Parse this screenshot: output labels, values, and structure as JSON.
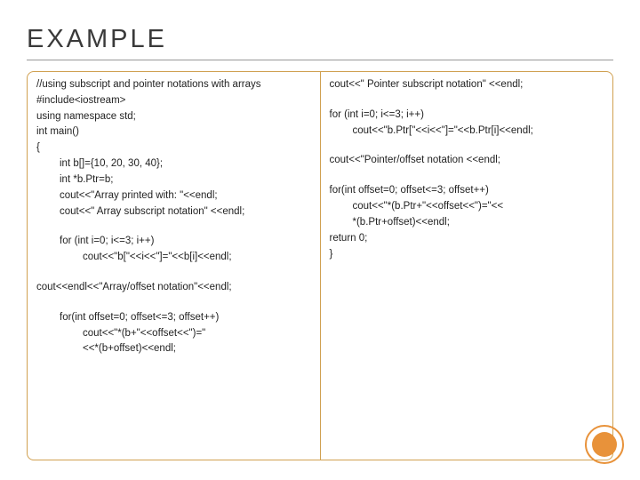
{
  "title": "EXAMPLE",
  "left": {
    "l1": "//using subscript and pointer notations with arrays",
    "l2": "#include<iostream>",
    "l3": "using namespace std;",
    "l4": "int main()",
    "l5": "{",
    "l6": "int b[]={10, 20, 30, 40};",
    "l7": "int *b.Ptr=b;",
    "l8": "cout<<\"Array printed with: \"<<endl;",
    "l9": "cout<<\" Array subscript notation\" <<endl;",
    "l10": "for (int i=0; i<=3; i++)",
    "l11": "cout<<\"b[\"<<i<<\"]=\"<<b[i]<<endl;",
    "l12": "cout<<endl<<\"Array/offset notation\"<<endl;",
    "l13": "for(int offset=0; offset<=3; offset++)",
    "l14": "cout<<\"*(b+\"<<offset<<\")=\"",
    "l15": "<<*(b+offset)<<endl;"
  },
  "right": {
    "r1": "cout<<\" Pointer subscript notation\" <<endl;",
    "r2": "for (int i=0; i<=3; i++)",
    "r3": "cout<<\"b.Ptr[\"<<i<<\"]=\"<<b.Ptr[i]<<endl;",
    "r4": "cout<<\"Pointer/offset notation <<endl;",
    "r5": "for(int offset=0; offset<=3; offset++)",
    "r6": "cout<<\"*(b.Ptr+\"<<offset<<\")=\"<<",
    "r7": "*(b.Ptr+offset)<<endl;",
    "r8": "return 0;",
    "r9": "}"
  }
}
